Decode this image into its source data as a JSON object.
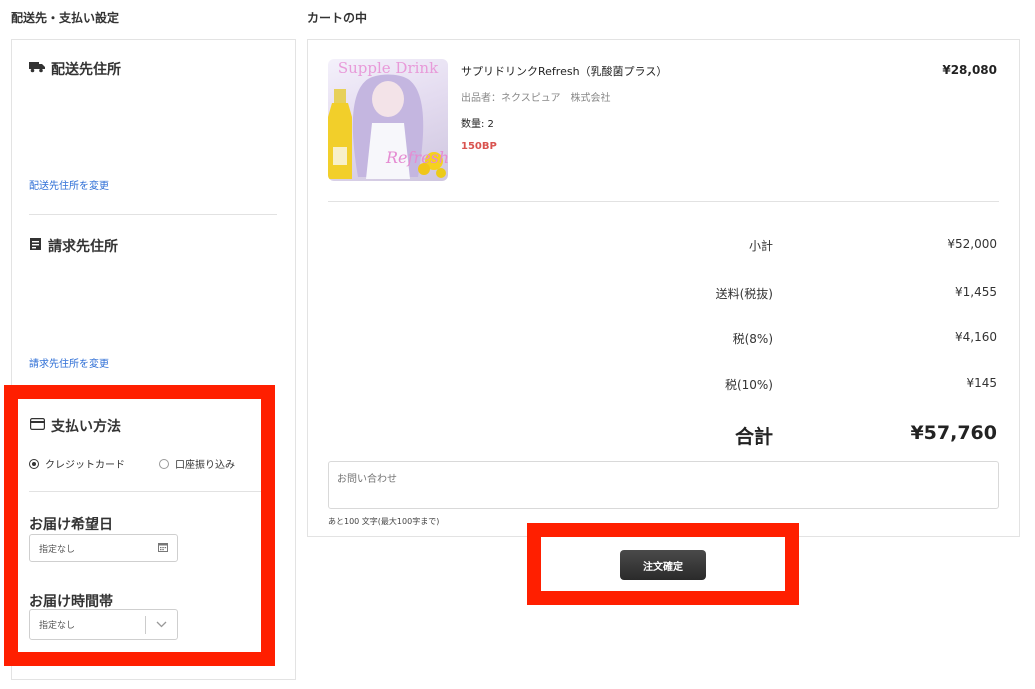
{
  "left_section": {
    "title": "配送先・支払い設定",
    "shipping": {
      "title": "配送先住所",
      "icon": "truck-icon",
      "change_link": "配送先住所を変更"
    },
    "billing": {
      "title": "請求先住所",
      "icon": "receipt-icon",
      "change_link": "請求先住所を変更"
    },
    "payment": {
      "title": "支払い方法",
      "icon": "credit-card-icon",
      "options": [
        {
          "label": "クレジットカード",
          "selected": true
        },
        {
          "label": "口座振り込み",
          "selected": false
        }
      ]
    },
    "delivery_date": {
      "label": "お届け希望日",
      "value": "指定なし",
      "icon": "calendar-icon"
    },
    "delivery_time": {
      "label": "お届け時間帯",
      "value": "指定なし",
      "icon": "chevron-down-icon"
    }
  },
  "cart": {
    "title": "カートの中",
    "item": {
      "name": "サプリドリンクRefresh（乳酸菌プラス）",
      "seller": "出品者：ネクスピュア　株式会社",
      "quantity": "数量: 2",
      "points": "150BP",
      "price": "¥28,080",
      "image_text_top": "Supple Drink",
      "image_text_script": "Refresh"
    },
    "summary": [
      {
        "label": "小計",
        "value": "¥52,000"
      },
      {
        "label": "送料(税抜)",
        "value": "¥1,455"
      },
      {
        "label": "税(8%)",
        "value": "¥4,160"
      },
      {
        "label": "税(10%)",
        "value": "¥145"
      }
    ],
    "total": {
      "label": "合計",
      "value": "¥57,760"
    },
    "inquiry": {
      "placeholder": "お問い合わせ",
      "counter": "あと100 文字(最大100字まで)"
    },
    "submit_label": "注文確定"
  },
  "colors": {
    "highlight": "#ff1f00",
    "link": "#2f6fd6",
    "points": "#d9534f",
    "button": "#333333"
  }
}
